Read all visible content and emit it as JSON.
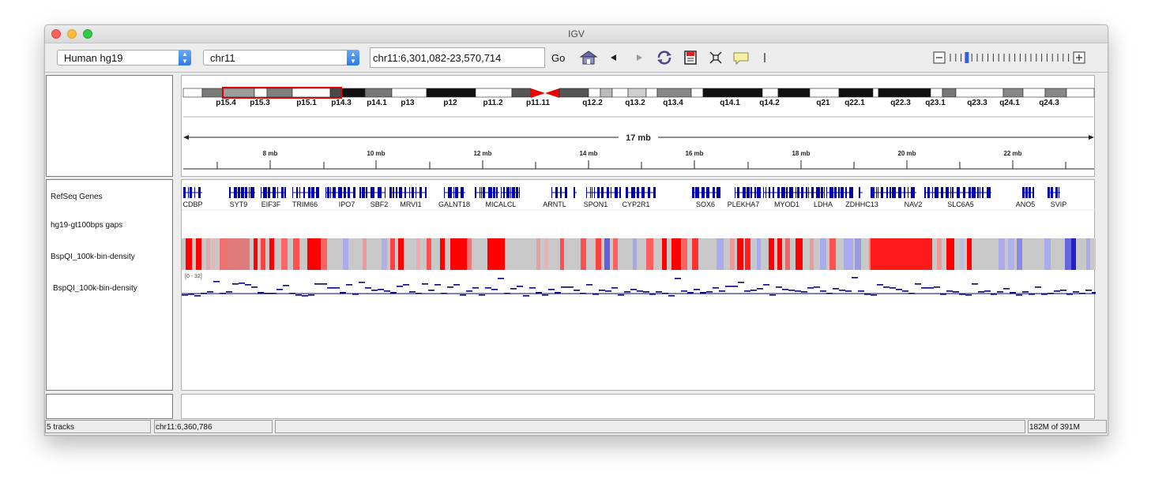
{
  "window": {
    "title": "IGV"
  },
  "toolbar": {
    "genome": "Human hg19",
    "chromosome": "chr11",
    "locus": "chr11:6,301,082-23,570,714",
    "go_label": "Go"
  },
  "ideogram": {
    "bands": [
      "p15.4",
      "p15.3",
      "p15.1",
      "p14.3",
      "p14.1",
      "p13",
      "p12",
      "p11.2",
      "p11.11",
      "q12.2",
      "q13.2",
      "q13.4",
      "q14.1",
      "q14.2",
      "q21",
      "q22.1",
      "q22.3",
      "q23.1",
      "q23.3",
      "q24.1",
      "q24.3"
    ]
  },
  "ruler": {
    "span_label": "17 mb",
    "ticks": [
      "8 mb",
      "10 mb",
      "12 mb",
      "14 mb",
      "16 mb",
      "18 mb",
      "20 mb",
      "22 mb"
    ]
  },
  "tracks": {
    "names": [
      "RefSeq Genes",
      "hg19-gt100bps gaps",
      "BspQI_100k-bin-density",
      "BspQI_100k-bin-density"
    ],
    "genes": [
      "CDBP",
      "SYT9",
      "EIF3F",
      "TRIM66",
      "IPO7",
      "SBF2",
      "MRVI1",
      "GALNT18",
      "MICALCL",
      "ARNTL",
      "SPON1",
      "CYP2R1",
      "SOX6",
      "PLEKHA7",
      "MYOD1",
      "LDHA",
      "ZDHHC13",
      "NAV2",
      "SLC6A5",
      "ANO5",
      "SVIP"
    ],
    "data_range": "[0 - 32]"
  },
  "status": {
    "track_count": "5 tracks",
    "position": "chr11:6,360,786",
    "memory": "182M of 391M"
  },
  "colors": {
    "gene": "#0000b3",
    "high": "#ff0000",
    "low": "#3333cc",
    "mid": "#c8c8c8",
    "ideogram_outline": "#e00000"
  }
}
